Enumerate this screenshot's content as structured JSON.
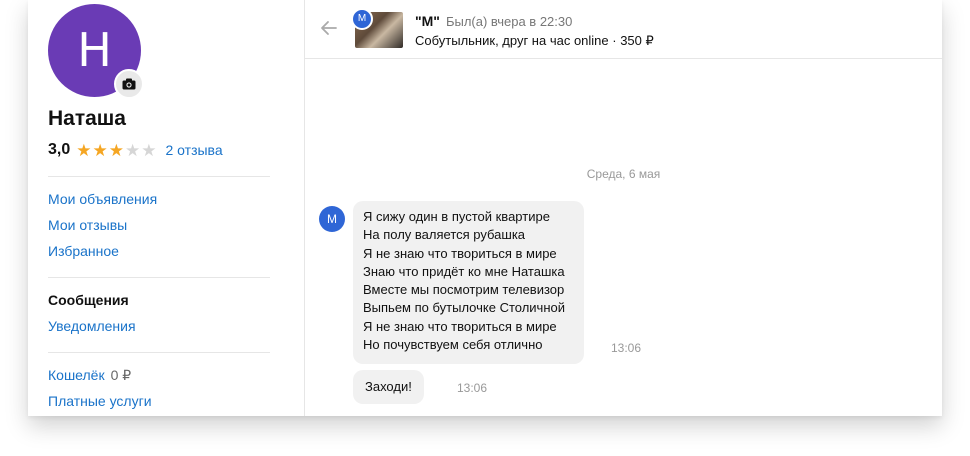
{
  "profile": {
    "avatar_letter": "H",
    "name": "Наташа",
    "rating": "3,0",
    "stars_filled": 3,
    "stars_total": 5,
    "reviews_link": "2 отзыва"
  },
  "menu": {
    "my_ads": "Мои объявления",
    "my_reviews": "Мои отзывы",
    "favorites": "Избранное",
    "messages": "Сообщения",
    "notifications": "Уведомления",
    "wallet": "Кошелёк",
    "wallet_amount": "0 ₽",
    "paid_services": "Платные услуги"
  },
  "chat_header": {
    "seller_avatar_letter": "M",
    "title": "\"M\"",
    "status": "Был(а) вчера в 22:30",
    "listing": "Собутыльник, друг на час online · 350 ₽"
  },
  "messages": {
    "date_separator": "Среда, 6 мая",
    "sender_avatar_letter": "M",
    "message1_lines": [
      "Я сижу один в пустой квартире",
      "На полу валяется рубашка",
      "Я не знаю что твориться в мире",
      "Знаю что придёт ко мне Наташка",
      "Вместе мы посмотрим телевизор",
      "Выпьем по бутылочке Столичной",
      "Я не знаю что твориться в мире",
      "Но почувствуем себя отлично"
    ],
    "message1_time": "13:06",
    "message2_text": "Заходи!",
    "message2_time": "13:06"
  },
  "colors": {
    "avatar_purple": "#6a3bb5",
    "link_blue": "#1a73c9",
    "star_orange": "#f5a623",
    "seller_blue": "#2f66d6"
  }
}
